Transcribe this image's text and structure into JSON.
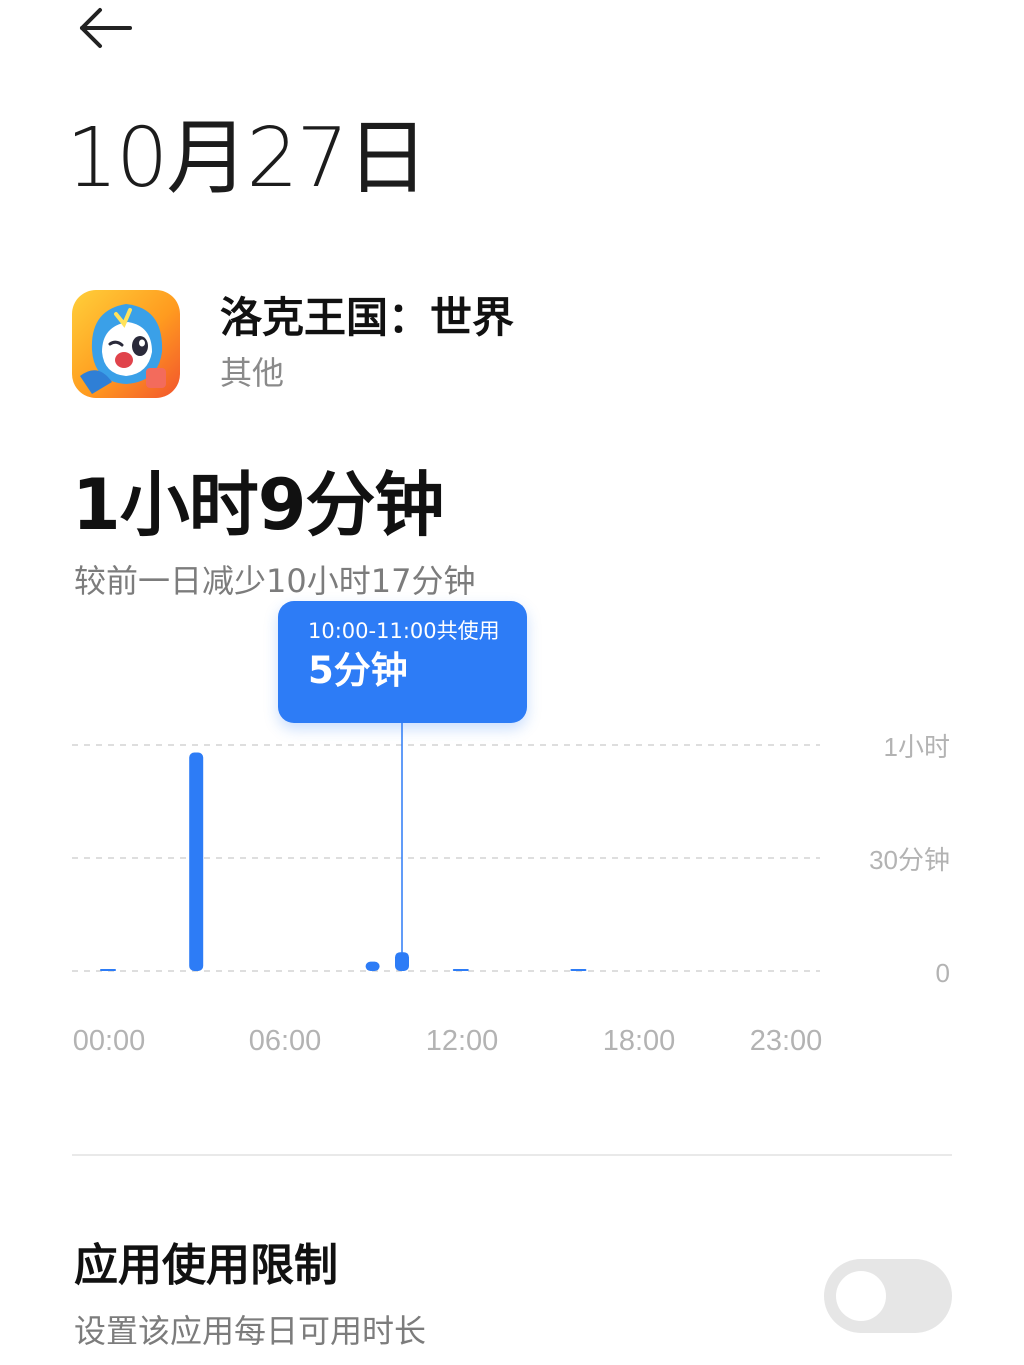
{
  "header": {
    "back_icon": "arrow-left-icon",
    "date": "10月27日"
  },
  "app": {
    "name": "洛克王国：世界",
    "category": "其他",
    "icon": "app-icon"
  },
  "usage": {
    "total": "1小时9分钟",
    "compare": "较前一日减少10小时17分钟"
  },
  "tooltip": {
    "range": "10:00-11:00共使用",
    "value": "5分钟"
  },
  "chart_data": {
    "type": "bar",
    "xlabel": "",
    "ylabel": "",
    "x_tick_labels": [
      "00:00",
      "06:00",
      "12:00",
      "18:00",
      "23:00"
    ],
    "y_tick_labels": [
      "1小时",
      "30分钟",
      "0"
    ],
    "y_unit": "minutes",
    "ylim": [
      0,
      60
    ],
    "grid": true,
    "selected_hour": 10,
    "hours": [
      0,
      1,
      2,
      3,
      4,
      5,
      6,
      7,
      8,
      9,
      10,
      11,
      12,
      13,
      14,
      15,
      16,
      17,
      18,
      19,
      20,
      21,
      22,
      23
    ],
    "values": [
      0.3,
      0,
      0,
      58,
      0,
      0,
      0,
      0,
      0,
      2.5,
      5,
      0,
      0.3,
      0,
      0,
      0,
      0.3,
      0,
      0,
      0,
      0,
      0,
      0,
      0
    ],
    "color": "#2d7cf6"
  },
  "limit": {
    "title": "应用使用限制",
    "subtitle": "设置该应用每日可用时长",
    "enabled": false
  }
}
